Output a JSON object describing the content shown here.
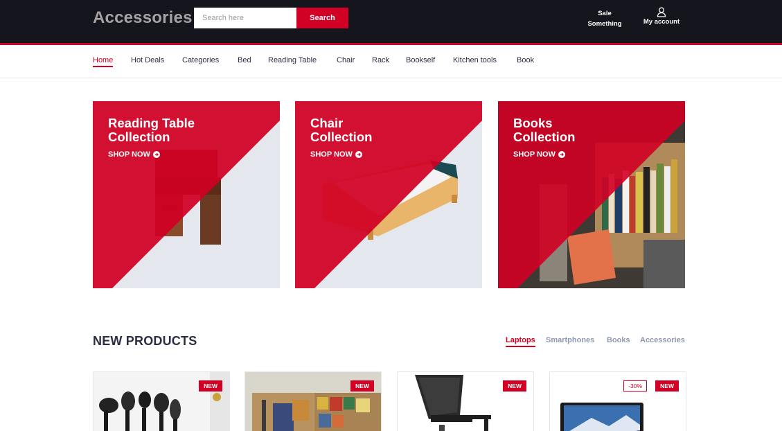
{
  "header": {
    "logo": "Accessories",
    "search": {
      "placeholder": "Search here",
      "button_label": "Search"
    },
    "links": [
      {
        "line1": "Sale",
        "line2": "Something"
      },
      {
        "label": "My account",
        "icon": "user-icon"
      }
    ]
  },
  "nav": {
    "items": [
      "Home",
      "Hot Deals",
      "Categories",
      "Bed",
      "Reading Table",
      "Chair",
      "Rack",
      "Bookself",
      "Kitchen tools",
      "Book"
    ],
    "active": "Home"
  },
  "collections": [
    {
      "title_line1": "Reading Table",
      "title_line2": "Collection",
      "cta": "SHOP NOW",
      "icon": "arrow-circle-right-icon"
    },
    {
      "title_line1": "Chair",
      "title_line2": "Collection",
      "cta": "SHOP NOW",
      "icon": "arrow-circle-right-icon"
    },
    {
      "title_line1": "Books",
      "title_line2": "Collection",
      "cta": "SHOP NOW",
      "icon": "arrow-circle-right-icon"
    }
  ],
  "new_products": {
    "title": "NEW PRODUCTS",
    "tabs": [
      "Laptops",
      "Smartphones",
      "Books",
      "Accessories"
    ],
    "active_tab": "Laptops",
    "products": [
      {
        "image": "kitchen-utensils",
        "badges": [
          "NEW"
        ]
      },
      {
        "image": "books-in-boxes",
        "badges": [
          "NEW"
        ]
      },
      {
        "image": "office-chair",
        "badges": [
          "NEW"
        ]
      },
      {
        "image": "laptop",
        "sale": "-30%",
        "badges": [
          "NEW"
        ]
      }
    ]
  },
  "colors": {
    "accent": "#d10024",
    "header_bg": "#15161d",
    "text": "#2b2d42",
    "muted": "#8d99ae",
    "card_bg": "#e4e7ed"
  }
}
